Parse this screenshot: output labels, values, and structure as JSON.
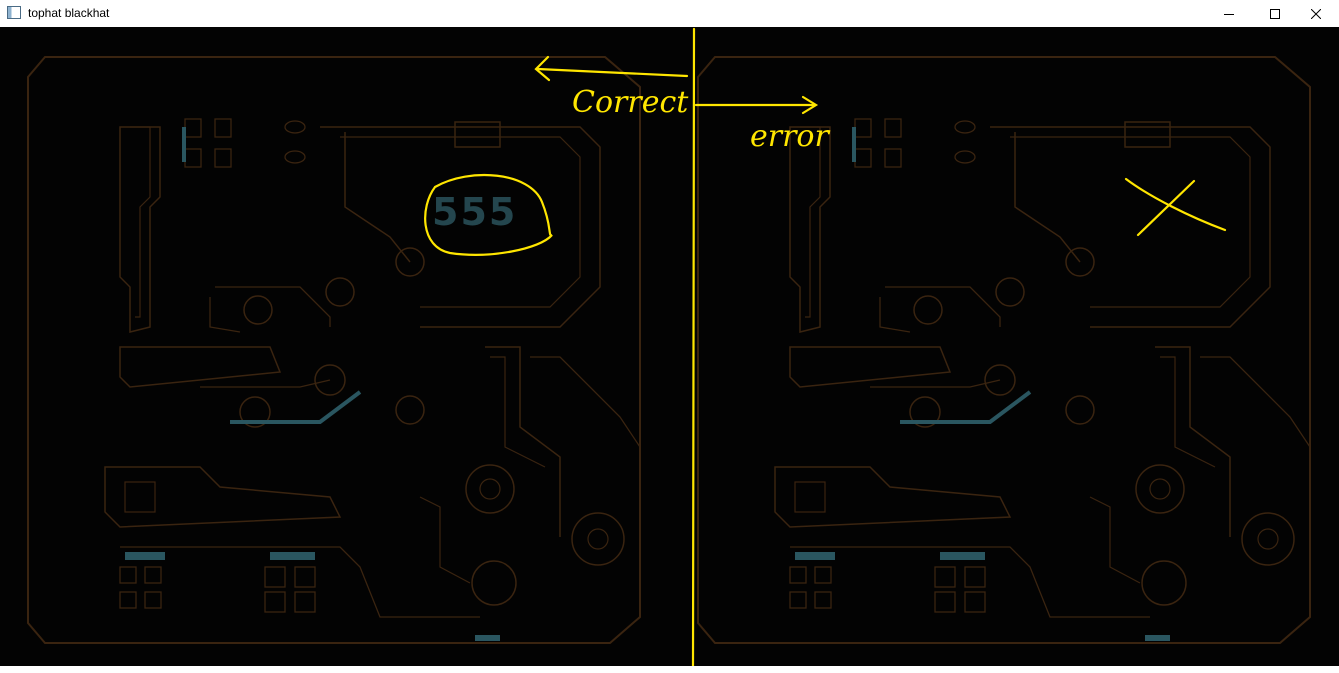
{
  "window": {
    "title": "tophat blackhat",
    "icon": "app-window-icon",
    "controls": {
      "minimize_icon": "minimize-icon",
      "maximize_icon": "maximize-icon",
      "close_icon": "close-icon"
    }
  },
  "image_view": {
    "background_color": "#030303",
    "trace_color": "#3a2410",
    "highlight_color": "#2a5660",
    "annotation_color": "#ffe600"
  },
  "annotations": {
    "left_label": "Correct",
    "right_label": "error",
    "chip_label": "555"
  }
}
